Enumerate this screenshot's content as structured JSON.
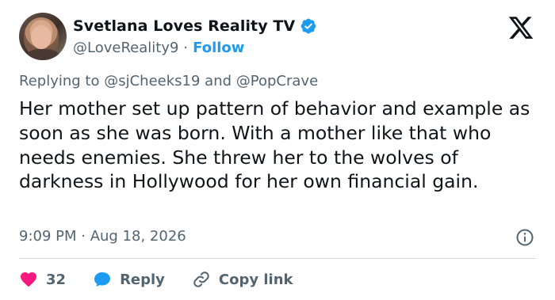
{
  "author": {
    "display_name": "Svetlana Loves Reality TV",
    "handle": "@LoveReality9",
    "separator": "·",
    "follow_label": "Follow"
  },
  "reply_context": {
    "prefix": "Replying to",
    "mention_1": "@sjCheeks19",
    "conjunction": "and",
    "mention_2": "@PopCrave"
  },
  "tweet": {
    "text": "Her mother set up pattern of behavior and example as soon as she was born. With a mother like that who needs enemies. She threw her to the wolves of darkness in Hollywood for her own financial gain.",
    "timestamp": "9:09 PM · Aug 18, 2026"
  },
  "actions": {
    "like_count": "32",
    "reply_label": "Reply",
    "copy_link_label": "Copy link"
  },
  "icons": {
    "brand": "x-logo-icon",
    "verified": "verified-badge-icon",
    "info": "info-icon",
    "like": "heart-icon",
    "reply": "speech-bubble-icon",
    "copy_link": "link-icon"
  },
  "colors": {
    "text": "#0f1419",
    "secondary": "#536471",
    "accent": "#1d9bf0",
    "like": "#f91880",
    "divider": "#cfd9de"
  }
}
